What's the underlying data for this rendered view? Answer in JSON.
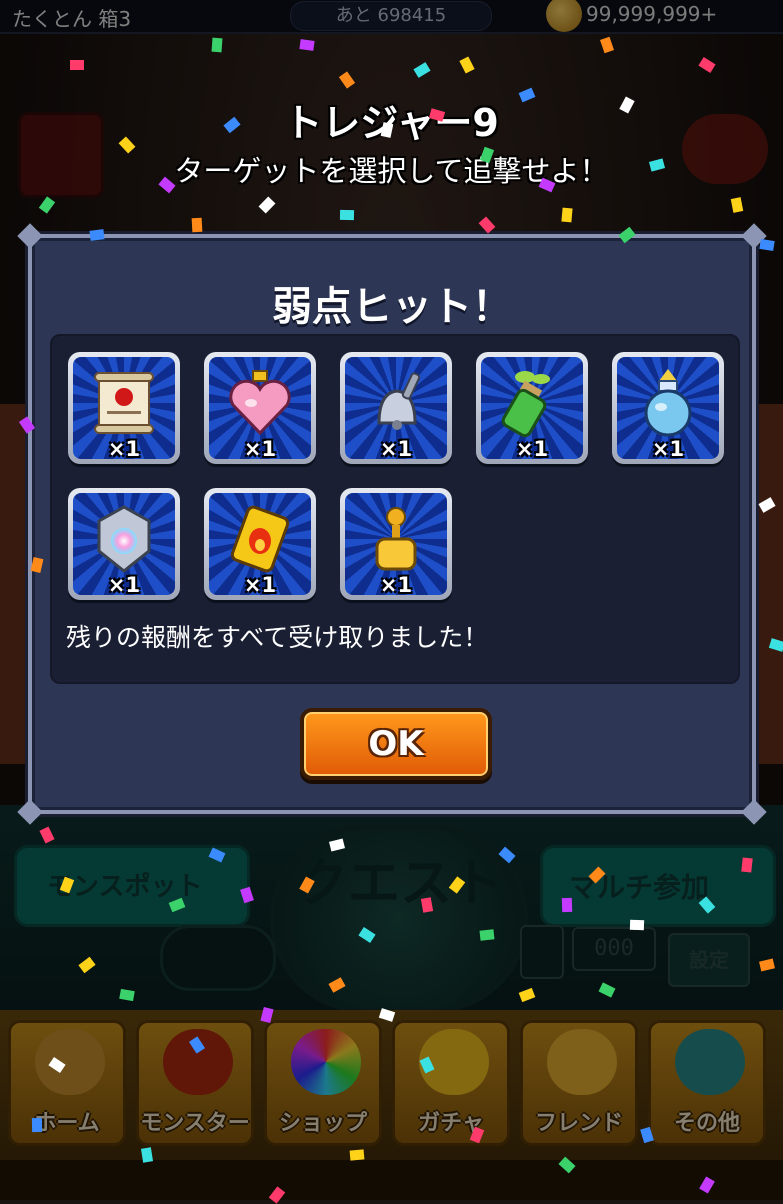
{
  "status_bar": {
    "title": "たくとん 箱3",
    "remaining": "あと 698415",
    "coins": "99,999,999+"
  },
  "overlay": {
    "title": "トレジャー9",
    "subtitle": "ターゲットを選択して追撃せよ！"
  },
  "dialog": {
    "title": "弱点ヒット！",
    "rewards": [
      {
        "icon": "scroll-icon",
        "count": "×1"
      },
      {
        "icon": "heart-potion-icon",
        "count": "×1"
      },
      {
        "icon": "bell-icon",
        "count": "×1"
      },
      {
        "icon": "sprout-bottle-icon",
        "count": "×1"
      },
      {
        "icon": "blue-orb-jar-icon",
        "count": "×1"
      },
      {
        "icon": "rainbow-crest-icon",
        "count": "×1"
      },
      {
        "icon": "fire-can-icon",
        "count": "×1"
      },
      {
        "icon": "gold-pawn-bottle-icon",
        "count": "×1"
      }
    ],
    "message": "残りの報酬をすべて受け取りました！",
    "ok_label": "OK"
  },
  "background": {
    "quest_label": "クエスト",
    "monspot_label": "モンスポット",
    "multi_label": "マルチ参加",
    "code_placeholder": "000",
    "settings_label": "設定"
  },
  "nav": {
    "items": [
      {
        "label": "ホーム",
        "icon": "home-icon"
      },
      {
        "label": "モンスター",
        "icon": "monster-icon"
      },
      {
        "label": "ショップ",
        "icon": "shop-orb-icon"
      },
      {
        "label": "ガチャ",
        "icon": "gacha-egg-icon"
      },
      {
        "label": "フレンド",
        "icon": "friends-icon"
      },
      {
        "label": "その他",
        "icon": "other-icon"
      }
    ]
  },
  "colors": {
    "dialog_bg": "#2e3656",
    "ok_button": "#f07a10",
    "slot_bg": "#1f4fc8"
  }
}
